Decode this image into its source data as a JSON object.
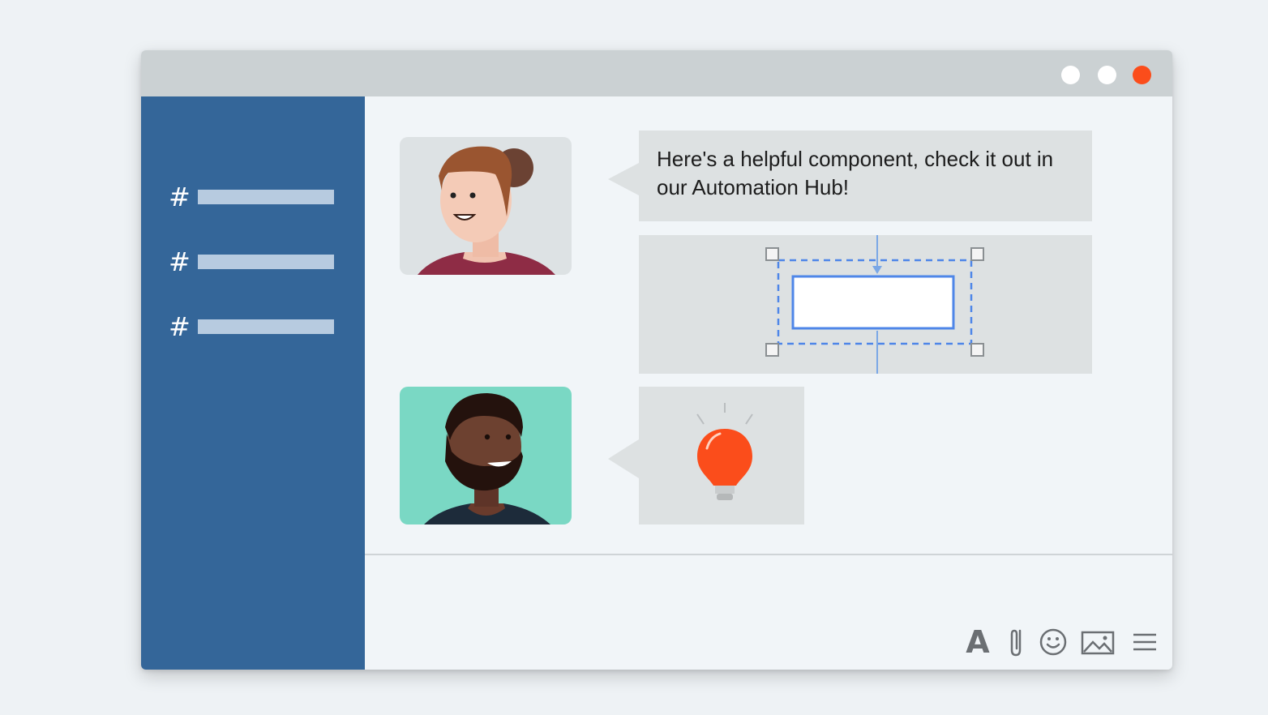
{
  "window": {
    "controls": [
      "minimize",
      "maximize",
      "close"
    ],
    "close_color": "#fb4d1b"
  },
  "sidebar": {
    "background": "#346699",
    "channels": [
      {
        "symbol": "#"
      },
      {
        "symbol": "#"
      },
      {
        "symbol": "#"
      }
    ]
  },
  "chat": {
    "messages": [
      {
        "avatar": "woman-avatar",
        "text": "Here's a helpful component, check it out in our Automation Hub!",
        "attachment": "component-preview"
      },
      {
        "avatar": "man-avatar",
        "attachment": "lightbulb-icon"
      }
    ]
  },
  "composer": {
    "tools": [
      {
        "name": "format-text",
        "label": "A"
      },
      {
        "name": "paperclip-icon"
      },
      {
        "name": "emoji-icon"
      },
      {
        "name": "image-icon"
      },
      {
        "name": "menu-icon"
      }
    ]
  }
}
